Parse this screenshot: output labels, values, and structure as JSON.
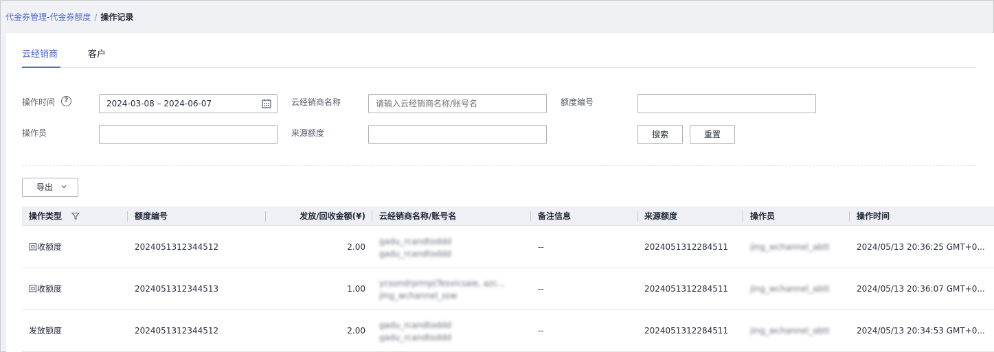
{
  "breadcrumb": {
    "parent": "代金券管理-代金券额度",
    "separator": "/",
    "current": "操作记录"
  },
  "tabs": [
    {
      "label": "云经销商",
      "active": true
    },
    {
      "label": "客户",
      "active": false
    }
  ],
  "filters": {
    "op_time_label": "操作时间",
    "op_time_value": "2024-03-08 – 2024-06-07",
    "partner_label": "云经销商名称",
    "partner_placeholder": "请输入云经销商名称/账号名",
    "quota_no_label": "额度编号",
    "quota_no_value": "",
    "operator_label": "操作员",
    "operator_value": "",
    "source_label": "来源额度",
    "source_value": "",
    "search_button": "搜索",
    "reset_button": "重置"
  },
  "export_button": "导出",
  "table": {
    "columns": [
      "操作类型",
      "额度编号",
      "发放/回收金额(¥)",
      "云经销商名称/账号名",
      "备注信息",
      "来源额度",
      "操作员",
      "操作时间"
    ],
    "rows": [
      {
        "type": "回收额度",
        "quota_no": "2024051312344512",
        "amount": "2.00",
        "partner_line1": "gadu_rcandtoddd",
        "partner_line2": "gadu_rcandtoddd",
        "remark": "--",
        "source": "2024051312284511",
        "operator": "jing_wchannel_abtt",
        "time": "2024/05/13 20:36:25 GMT+0..."
      },
      {
        "type": "回收额度",
        "quota_no": "2024051312344513",
        "amount": "1.00",
        "partner_line1": "ycsondrprmp(Tesvicsaie, azc...",
        "partner_line2": "jing_wchannel_ssw",
        "remark": "--",
        "source": "2024051312284511",
        "operator": "jing_wchannel_abtt",
        "time": "2024/05/13 20:36:07 GMT+0..."
      },
      {
        "type": "发放额度",
        "quota_no": "2024051312344512",
        "amount": "2.00",
        "partner_line1": "gadu_rcandtoddd",
        "partner_line2": "gadu_rcandtoddd",
        "remark": "--",
        "source": "2024051312284511",
        "operator": "jing_wchannel_abtt",
        "time": "2024/05/13 20:34:53 GMT+0..."
      }
    ]
  },
  "colors": {
    "accent": "#526ecc",
    "header_bg": "#eef0f5",
    "page_bg": "#f0f1f4"
  },
  "icons": {
    "help": "question-circle-icon",
    "calendar": "calendar-icon",
    "export_chevron": "chevron-down-icon",
    "filter": "filter-icon"
  }
}
